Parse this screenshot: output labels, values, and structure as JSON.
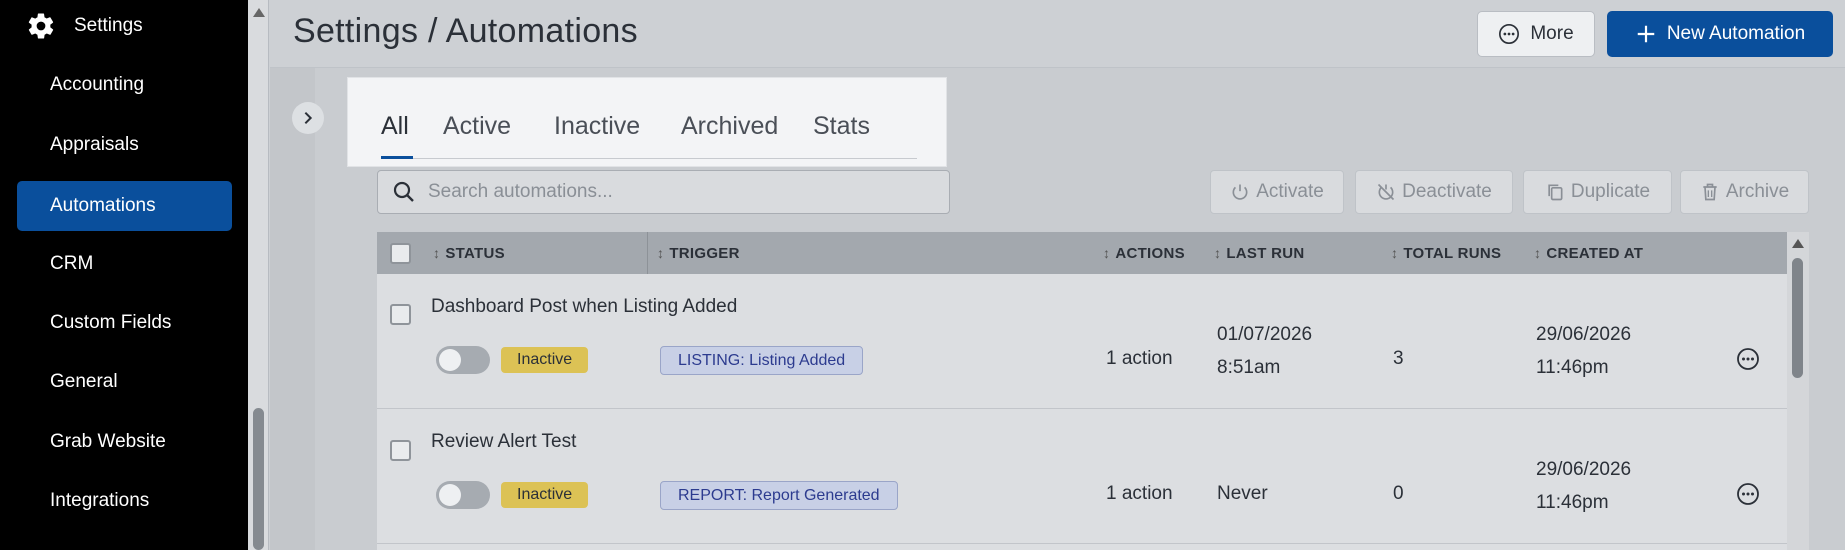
{
  "sidebar": {
    "header_label": "Settings",
    "items": [
      {
        "label": "Accounting"
      },
      {
        "label": "Appraisals"
      },
      {
        "label": "Automations"
      },
      {
        "label": "CRM"
      },
      {
        "label": "Custom Fields"
      },
      {
        "label": "General"
      },
      {
        "label": "Grab Website"
      },
      {
        "label": "Integrations"
      }
    ],
    "active_item": "Automations"
  },
  "header": {
    "title": "Settings / Automations",
    "more_label": "More",
    "new_label": "New Automation"
  },
  "tabs": [
    {
      "label": "All"
    },
    {
      "label": "Active"
    },
    {
      "label": "Inactive"
    },
    {
      "label": "Archived"
    },
    {
      "label": "Stats"
    }
  ],
  "active_tab": "All",
  "search": {
    "placeholder": "Search automations..."
  },
  "bulk_actions": {
    "activate": "Activate",
    "deactivate": "Deactivate",
    "duplicate": "Duplicate",
    "archive": "Archive"
  },
  "table": {
    "columns": {
      "status": "STATUS",
      "trigger": "TRIGGER",
      "actions": "ACTIONS",
      "last_run": "LAST RUN",
      "total_runs": "TOTAL RUNS",
      "created_at": "CREATED AT"
    },
    "rows": [
      {
        "name": "Dashboard Post when Listing Added",
        "status": "Inactive",
        "trigger": "LISTING: Listing Added",
        "actions": "1 action",
        "last_run_date": "01/07/2026",
        "last_run_time": "8:51am",
        "total_runs": "3",
        "created_date": "29/06/2026",
        "created_time": "11:46pm"
      },
      {
        "name": "Review Alert Test",
        "status": "Inactive",
        "trigger": "REPORT: Report Generated",
        "actions": "1 action",
        "last_run_date": "Never",
        "last_run_time": "",
        "total_runs": "0",
        "created_date": "29/06/2026",
        "created_time": "11:46pm"
      }
    ]
  },
  "colors": {
    "accent": "#0a4f9c",
    "sidebar_bg": "#000000",
    "inactive_badge": "#dcc255",
    "trigger_chip": "#c8d0e6"
  }
}
